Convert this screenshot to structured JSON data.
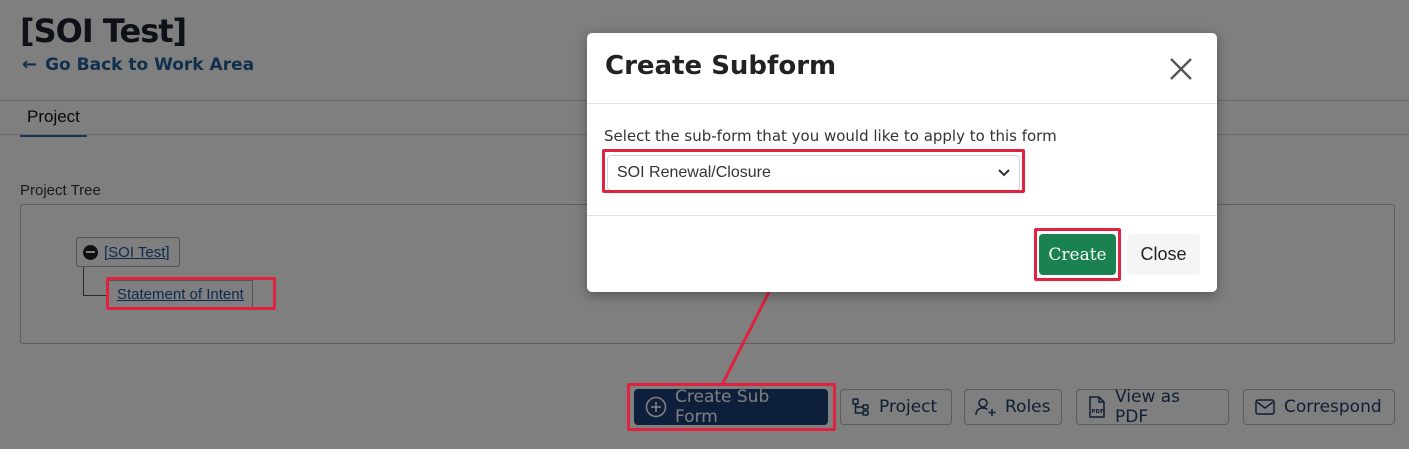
{
  "page": {
    "title": "[SOI Test]",
    "back_link": "Go Back to Work Area",
    "tabs": [
      "Project"
    ],
    "tree_label": "Project Tree",
    "tree": {
      "root": "[SOI Test]",
      "child": "Statement of Intent"
    }
  },
  "actions": {
    "create_sub_form": "Create Sub Form",
    "project": "Project",
    "roles": "Roles",
    "view_pdf": "View as PDF",
    "correspond": "Correspond"
  },
  "modal": {
    "title": "Create Subform",
    "select_label": "Select the sub-form that you would like to apply to this form",
    "selected_value": "SOI Renewal/Closure",
    "create_label": "Create",
    "close_label": "Close"
  },
  "colors": {
    "primary": "#1d3f78",
    "success": "#1a8150",
    "link": "#1f5f99",
    "highlight": "#e0223f"
  }
}
